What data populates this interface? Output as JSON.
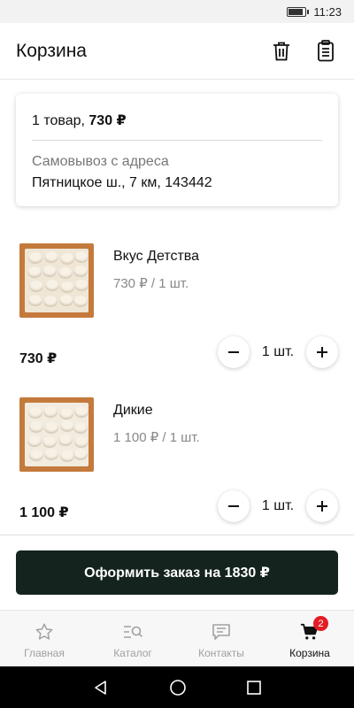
{
  "status_bar": {
    "time": "11:23"
  },
  "header": {
    "title": "Корзина",
    "trash_icon": "trash-icon",
    "clipboard_icon": "clipboard-icon"
  },
  "summary": {
    "count_label": "1 товар,",
    "total": "730 ₽",
    "pickup_label": "Самовывоз с адреса",
    "pickup_address": "Пятницкое ш., 7 км, 143442"
  },
  "items": [
    {
      "name": "Вкус Детства",
      "unit_price": "730 ₽ / 1 шт.",
      "total": "730 ₽",
      "quantity": "1 шт."
    },
    {
      "name": "Дикие",
      "unit_price": "1 100 ₽ / 1 шт.",
      "total": "1 100 ₽",
      "quantity": "1 шт."
    }
  ],
  "order_button": {
    "label": "Оформить заказ на 1830 ₽",
    "color": "#14231e"
  },
  "tabs": [
    {
      "label": "Главная",
      "icon": "star-icon"
    },
    {
      "label": "Каталог",
      "icon": "catalog-search-icon"
    },
    {
      "label": "Контакты",
      "icon": "chat-icon"
    },
    {
      "label": "Корзина",
      "icon": "cart-icon",
      "badge": "2",
      "active": true
    }
  ],
  "colors": {
    "badge": "#e31d24",
    "tab_active": "#111111",
    "tab_inactive": "#a0a0a0"
  }
}
